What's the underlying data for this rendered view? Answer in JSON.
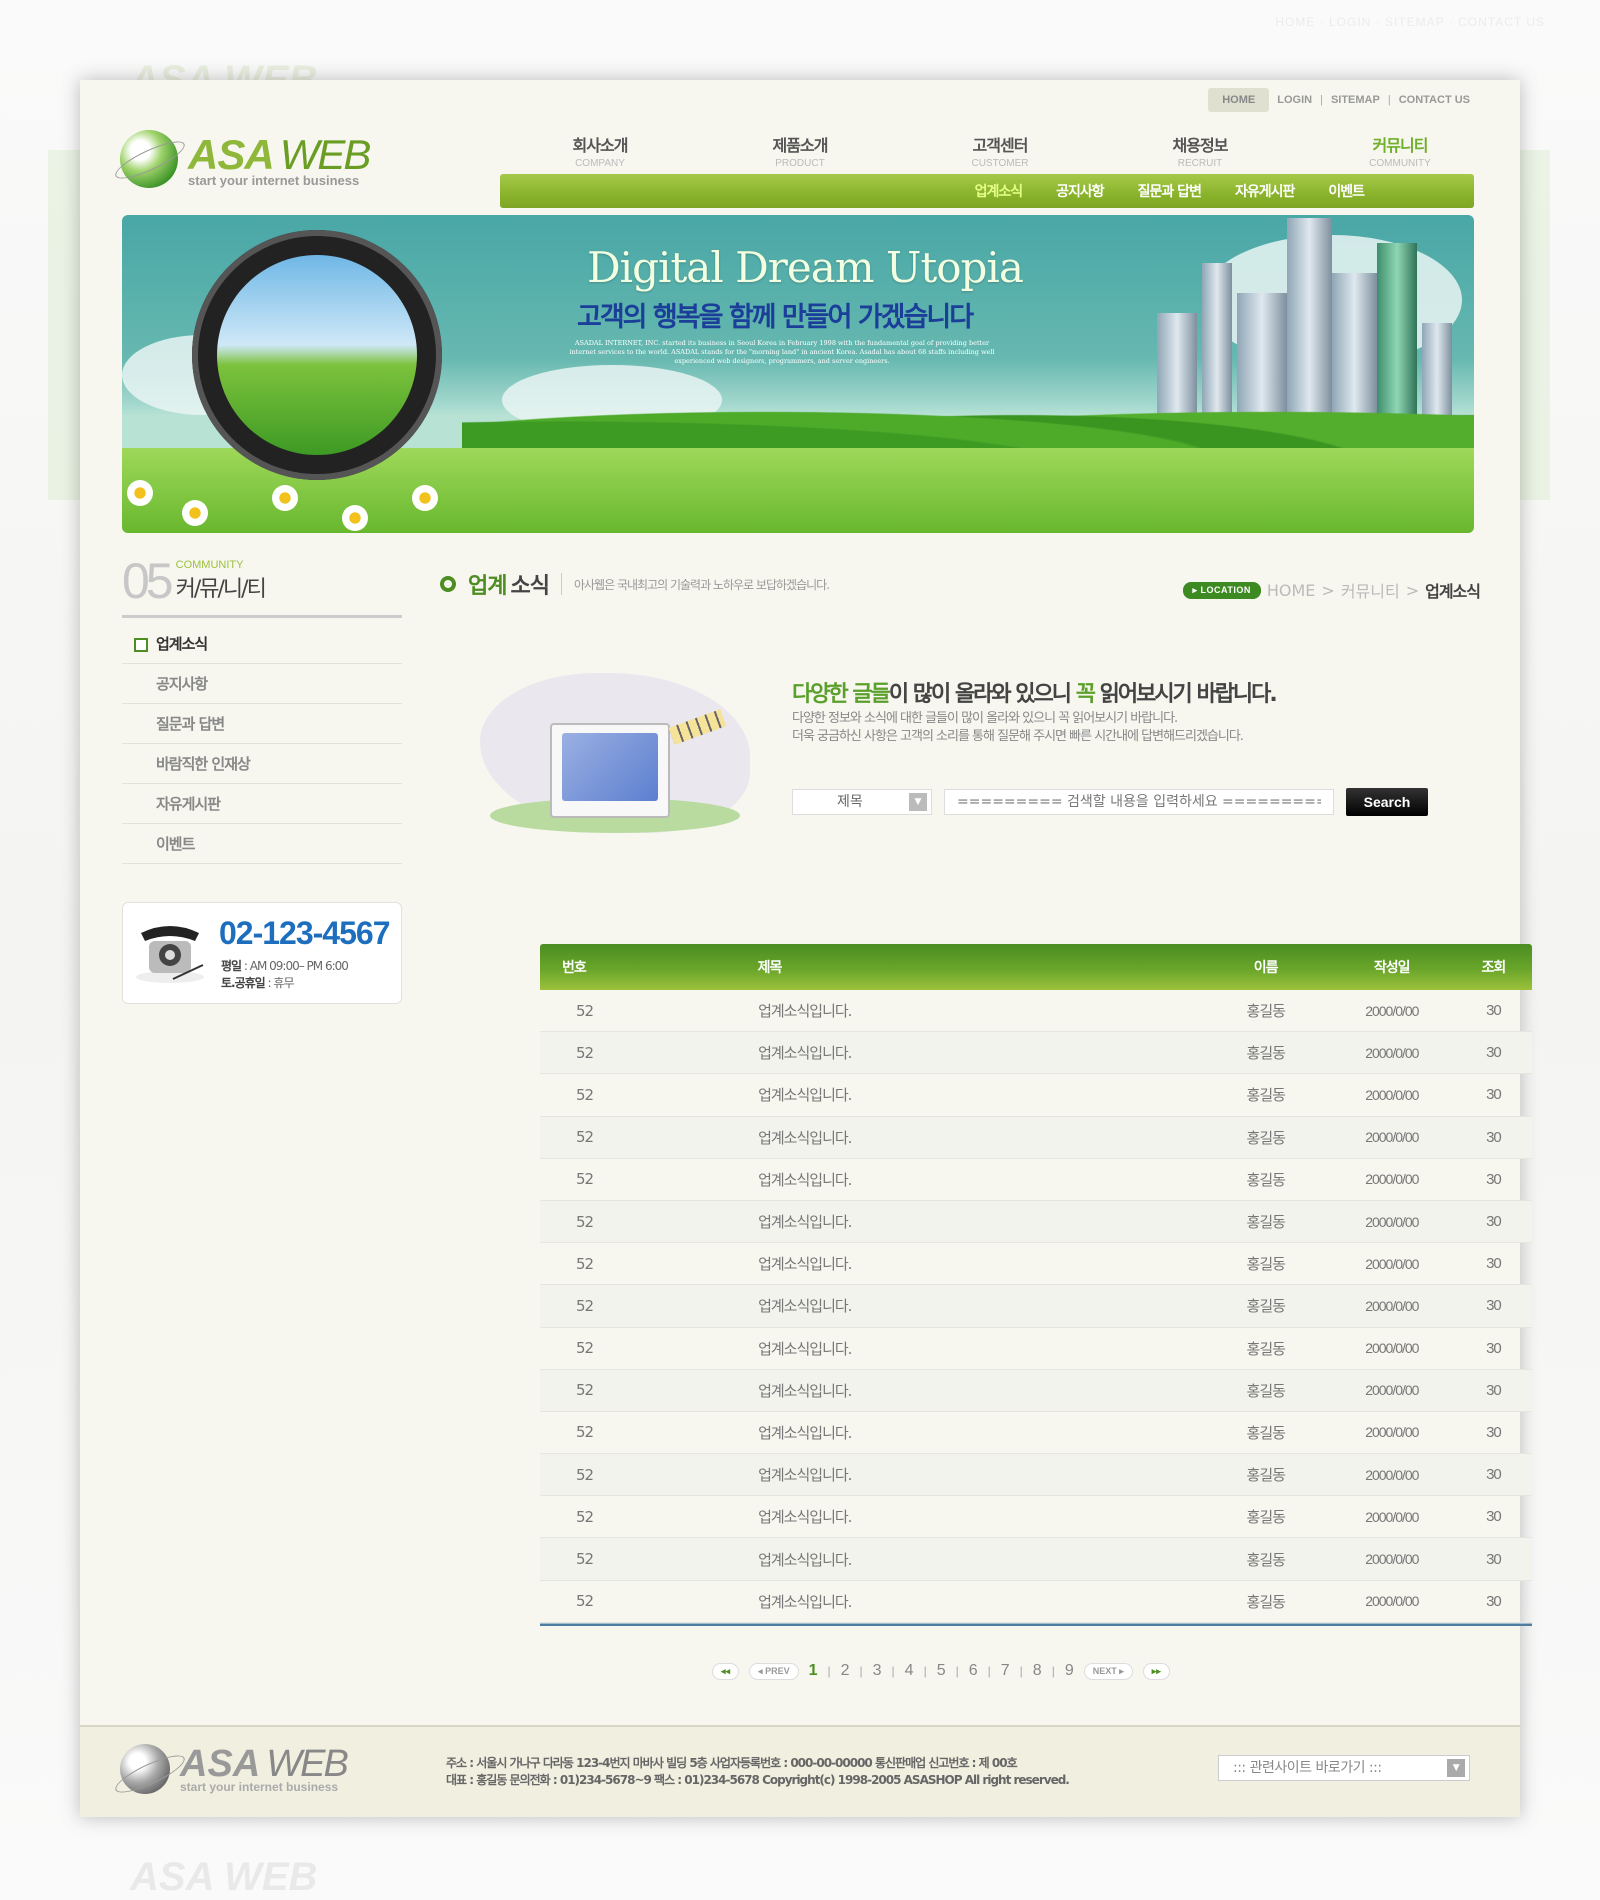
{
  "utility_links": {
    "home": "HOME",
    "login": "LOGIN",
    "sitemap": "SITEMAP",
    "contact": "CONTACT US",
    "separator": "|"
  },
  "logo": {
    "asa": "ASA",
    "web": "WEB",
    "tagline": "start your internet business"
  },
  "main_nav": [
    {
      "ko": "회사소개",
      "en": "COMPANY"
    },
    {
      "ko": "제품소개",
      "en": "PRODUCT"
    },
    {
      "ko": "고객센터",
      "en": "CUSTOMER"
    },
    {
      "ko": "채용정보",
      "en": "RECRUIT"
    },
    {
      "ko": "커뮤니티",
      "en": "COMMUNITY",
      "active": true
    }
  ],
  "sub_nav": [
    "업계소식",
    "공지사항",
    "질문과 답변",
    "자유게시판",
    "이벤트"
  ],
  "banner": {
    "title": "Digital Dream Utopia",
    "subtitle": "고객의 행복을 함께 만들어 가겠습니다",
    "small_text": "ASADAL INTERNET, INC. started its business in Seoul Korea in February 1998 with the fundamental goal of providing better internet services to the world. ASADAL stands for the \"morning land\" in ancient Korea. Asadal has about 68 staffs including well experienced web designers, programmers, and server engineers."
  },
  "sidebar": {
    "number": "05",
    "en_title": "COMMUNITY",
    "ko_title": "커/뮤/니/티",
    "items": [
      "업계소식",
      "공지사항",
      "질문과 답변",
      "바람직한 인재상",
      "자유게시판",
      "이벤트"
    ],
    "active_index": 0
  },
  "contact": {
    "phone": "02-123-4567",
    "weekday_label": "평일",
    "weekday_hours": " : AM 09:00– PM 6:00",
    "holiday_label": "토.공휴일",
    "holiday_hours": " : 휴무"
  },
  "content": {
    "title_green": "업계",
    "title_dark": "소식",
    "description": "아사웹은 국내최고의 기술력과 노하우로 보답하겠습니다.",
    "location": {
      "badge": "▸ LOCATION",
      "path": [
        "HOME",
        "커뮤니티"
      ],
      "current": "업계소식",
      "sep": ">"
    },
    "intro": {
      "headline_parts": [
        {
          "text": "다양한 글들",
          "green": true
        },
        {
          "text": "이 많이 올라와 있으니 ",
          "green": false
        },
        {
          "text": "꼭",
          "green": true
        },
        {
          "text": " 읽어보시기 바랍니다.",
          "green": false
        }
      ],
      "line1": "다양한 정보와 소식에 대한 글들이 많이 올라와 있으니 꼭 읽어보시기 바랍니다.",
      "line2": "더욱 궁금하신 사항은 고객의 소리를 통해 질문해 주시면 빠른 시간내에 답변해드리겠습니다."
    },
    "search": {
      "select_value": "제목",
      "placeholder": "========= 검색할 내용을 입력하세요 =========",
      "button": "Search"
    }
  },
  "board": {
    "columns": [
      "번호",
      "제목",
      "이름",
      "작성일",
      "조회"
    ],
    "rows": [
      [
        "52",
        "업계소식입니다.",
        "홍길동",
        "2000/0/00",
        "30"
      ],
      [
        "52",
        "업계소식입니다.",
        "홍길동",
        "2000/0/00",
        "30"
      ],
      [
        "52",
        "업계소식입니다.",
        "홍길동",
        "2000/0/00",
        "30"
      ],
      [
        "52",
        "업계소식입니다.",
        "홍길동",
        "2000/0/00",
        "30"
      ],
      [
        "52",
        "업계소식입니다.",
        "홍길동",
        "2000/0/00",
        "30"
      ],
      [
        "52",
        "업계소식입니다.",
        "홍길동",
        "2000/0/00",
        "30"
      ],
      [
        "52",
        "업계소식입니다.",
        "홍길동",
        "2000/0/00",
        "30"
      ],
      [
        "52",
        "업계소식입니다.",
        "홍길동",
        "2000/0/00",
        "30"
      ],
      [
        "52",
        "업계소식입니다.",
        "홍길동",
        "2000/0/00",
        "30"
      ],
      [
        "52",
        "업계소식입니다.",
        "홍길동",
        "2000/0/00",
        "30"
      ],
      [
        "52",
        "업계소식입니다.",
        "홍길동",
        "2000/0/00",
        "30"
      ],
      [
        "52",
        "업계소식입니다.",
        "홍길동",
        "2000/0/00",
        "30"
      ],
      [
        "52",
        "업계소식입니다.",
        "홍길동",
        "2000/0/00",
        "30"
      ],
      [
        "52",
        "업계소식입니다.",
        "홍길동",
        "2000/0/00",
        "30"
      ],
      [
        "52",
        "업계소식입니다.",
        "홍길동",
        "2000/0/00",
        "30"
      ]
    ]
  },
  "pagination": {
    "first": "◂◂",
    "prev": "◂ PREV",
    "pages": [
      "1",
      "2",
      "3",
      "4",
      "5",
      "6",
      "7",
      "8",
      "9"
    ],
    "current": "1",
    "next": "NEXT ▸",
    "last": "▸▸"
  },
  "footer": {
    "address_line1": "주소 : 서울시 가나구 다라동 123-4번지 마바사 빌딩 5층   사업자등록번호 : 000-00-00000   통신판매업 신고번호 : 제 00호",
    "address_line2": "대표 : 홍길동   문의전화 : 01)234-5678~9   팩스 : 01)234-5678   Copyright(c) 1998-2005 ASASHOP All right reserved.",
    "related_sites": "::: 관련사이트 바로가기 :::"
  },
  "colors": {
    "accent_green": "#6fb02a",
    "dark_green": "#4d8d22",
    "phone_blue": "#1d6fbd",
    "banner_title_blue": "#1b3f99"
  }
}
